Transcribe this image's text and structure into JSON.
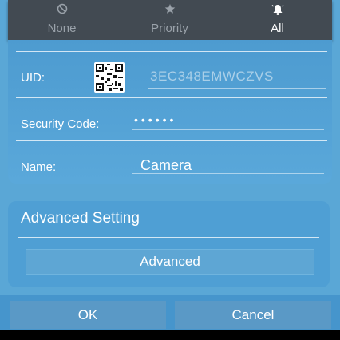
{
  "mode_bar": {
    "modes": [
      {
        "label": "None",
        "icon": "prohibited-icon"
      },
      {
        "label": "Priority",
        "icon": "star-icon"
      },
      {
        "label": "All",
        "icon": "bell-icon"
      }
    ],
    "selected": "All"
  },
  "device": {
    "uid_label": "UID:",
    "uid_value": "3EC348EMWCZVS",
    "security_label": "Security Code:",
    "security_value": "••••••",
    "name_label": "Name:",
    "name_value": "Camera"
  },
  "advanced": {
    "title": "Advanced Setting",
    "button_label": "Advanced"
  },
  "dialog": {
    "ok_label": "OK",
    "cancel_label": "Cancel"
  },
  "colors": {
    "background": "#5aa7d6",
    "mode_bar": "#424a52",
    "card": "#4f9fd4"
  }
}
